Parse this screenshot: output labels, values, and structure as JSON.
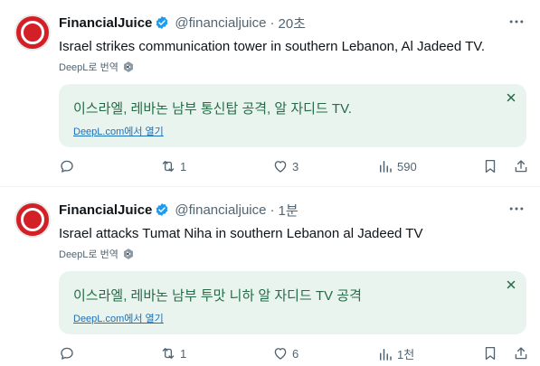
{
  "tweets": [
    {
      "author": "FinancialJuice",
      "handle": "@financialjuice",
      "separator": "·",
      "time": "20초",
      "text": "Israel strikes communication tower in southern Lebanon, Al Jadeed TV.",
      "deepl_label": "DeepL로 번역",
      "translation": "이스라엘, 레바논 남부 통신탑 공격, 알 자디드 TV.",
      "translation_link": "DeepL.com에서 열기",
      "replies": "",
      "retweets": "1",
      "likes": "3",
      "views": "590"
    },
    {
      "author": "FinancialJuice",
      "handle": "@financialjuice",
      "separator": "·",
      "time": "1분",
      "text": "Israel attacks Tumat Niha in southern Lebanon al Jadeed TV",
      "deepl_label": "DeepL로 번역",
      "translation": "이스라엘, 레바논 남부 투맛 니하 알 자디드 TV 공격",
      "translation_link": "DeepL.com에서 열기",
      "replies": "",
      "retweets": "1",
      "likes": "6",
      "views": "1천"
    }
  ],
  "icons": {
    "verified": "verified-badge-icon",
    "more": "more-options-icon",
    "reply": "reply-icon",
    "retweet": "retweet-icon",
    "like": "heart-icon",
    "views": "views-chart-icon",
    "bookmark": "bookmark-icon",
    "share": "share-icon",
    "close": "close-icon"
  },
  "colors": {
    "verified": "#1d9bf0",
    "avatar": "#d32026",
    "translation_bg": "#e9f4ef",
    "translation_text": "#256b46",
    "link": "#1d6fb8",
    "muted": "#536471"
  }
}
